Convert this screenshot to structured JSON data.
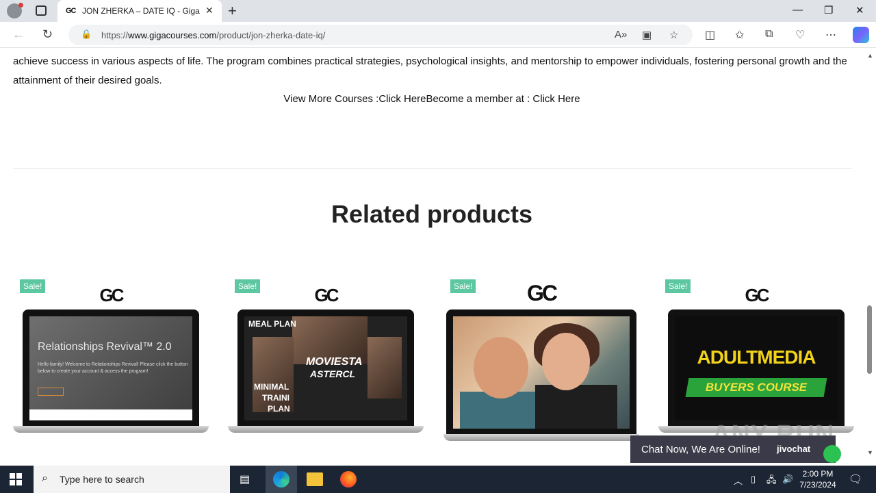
{
  "browser": {
    "tab_title": "JON ZHERKA – DATE IQ - Giga Co",
    "tab_favicon": "GC",
    "url_prefix": "https://",
    "url_domain": "www.gigacourses.com",
    "url_path": "/product/jon-zherka-date-iq/"
  },
  "page": {
    "description_partial": "achieve success in various aspects of life. The program combines practical strategies, psychological insights, and mentorship to empower individuals, fostering personal growth and the attainment of their desired goals.",
    "more_prefix": "View More Courses :",
    "more_link1": "Click Here",
    "more_middle": "Become a member at : ",
    "more_link2": "Click Here",
    "related_title": "Related products",
    "products": [
      {
        "badge": "Sale!",
        "logo": "GC",
        "screen_title": "Relationships Revival™ 2.0",
        "screen_sub": "Hello family! Welcome to Relationships Revival! Please click the button below to create your account & access the program!"
      },
      {
        "badge": "Sale!",
        "logo": "GC",
        "screen_labels": [
          "MEAL PLAN",
          "MOVIESTA",
          "ASTERCL",
          "MINIMAL",
          "TRAINI",
          "PLAN"
        ]
      },
      {
        "badge": "Sale!",
        "logo": "GC"
      },
      {
        "badge": "Sale!",
        "logo": "GC",
        "screen_title": "ADULTMEDIA",
        "screen_sub": "BUYERS COURSE"
      }
    ]
  },
  "chat": {
    "text": "Chat Now, We Are Online!",
    "brand": "jivochat"
  },
  "watermark": "ANY RUN",
  "taskbar": {
    "search_placeholder": "Type here to search",
    "time": "2:00 PM",
    "date": "7/23/2024"
  },
  "colors": {
    "sale_badge": "#5cc7a0",
    "chat_bg": "#3a3a48",
    "taskbar_bg": "#1c2533"
  }
}
